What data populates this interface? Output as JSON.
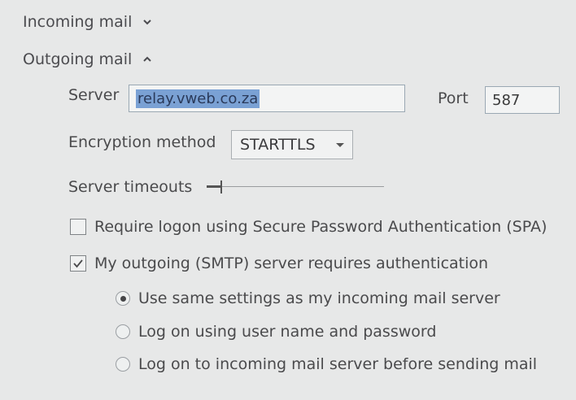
{
  "incoming": {
    "title": "Incoming mail",
    "expanded": false
  },
  "outgoing": {
    "title": "Outgoing mail",
    "expanded": true,
    "server_label": "Server",
    "server_value": "relay.vweb.co.za",
    "port_label": "Port",
    "port_value": "587",
    "encryption_label": "Encryption method",
    "encryption_value": "STARTTLS",
    "timeout_label": "Server timeouts",
    "timeout_fraction": 0.08,
    "spa_label": "Require logon using Secure Password Authentication (SPA)",
    "spa_checked": false,
    "auth_label": "My outgoing (SMTP) server requires authentication",
    "auth_checked": true,
    "auth_options": [
      {
        "label": "Use same settings as my incoming mail server",
        "selected": true
      },
      {
        "label": "Log on using user name and password",
        "selected": false
      },
      {
        "label": "Log on to incoming mail server before sending mail",
        "selected": false
      }
    ]
  },
  "icons": {
    "incoming_chevron": "chevron-down-icon",
    "outgoing_chevron": "chevron-up-icon",
    "checkmark": "checkmark-icon",
    "dropdown": "caret-down-icon"
  },
  "colors": {
    "background": "#e7e8e8",
    "selection": "#7aa1d4",
    "text": "#4a4a4c"
  }
}
